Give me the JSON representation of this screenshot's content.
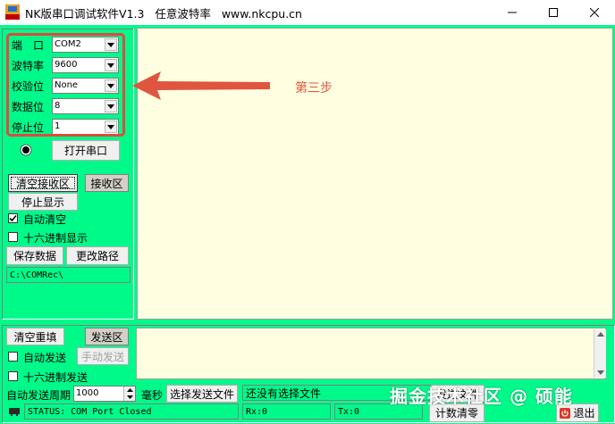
{
  "window": {
    "title": "NK版串口调试软件V1.3   任意波特率   www.nkcpu.cn",
    "app_icon_label": "COM"
  },
  "settings": {
    "port": {
      "label": "端　口",
      "value": "COM2"
    },
    "baud": {
      "label": "波特率",
      "value": "9600"
    },
    "parity": {
      "label": "校验位",
      "value": "None"
    },
    "databits": {
      "label": "数据位",
      "value": "8"
    },
    "stopbits": {
      "label": "停止位",
      "value": "1"
    }
  },
  "open_port_button": "打开串口",
  "receive": {
    "clear_button": "清空接收区",
    "area_tag": "接收区",
    "stop_display_button": "停止显示",
    "auto_clear_label": "自动清空",
    "auto_clear_checked": true,
    "hex_display_label": "十六进制显示",
    "hex_display_checked": false,
    "save_button": "保存数据",
    "change_path_button": "更改路径",
    "path": "C:\\COMRec\\"
  },
  "send": {
    "clear_button": "清空重填",
    "area_tag": "发送区",
    "auto_send_label": "自动发送",
    "auto_send_checked": false,
    "manual_send_button": "手动发送",
    "hex_send_label": "十六进制发送",
    "hex_send_checked": false,
    "period_label": "自动发送周期",
    "period_value": "1000",
    "period_unit": "毫秒",
    "select_file_button": "选择发送文件",
    "file_status": "还没有选择文件",
    "send_file_button": "发送文件",
    "reset_count_button": "计数清零",
    "exit_button": "退出"
  },
  "status_bar": {
    "status": "STATUS: COM Port Closed",
    "rx": "Rx:0",
    "tx": "Tx:0"
  },
  "annotation": {
    "step_text": "第三步"
  },
  "watermark": "掘金技术社区 @ 硕能",
  "colors": {
    "panel": "#00fa8a",
    "text_area": "#fefee0",
    "annotation": "#e0553f"
  }
}
